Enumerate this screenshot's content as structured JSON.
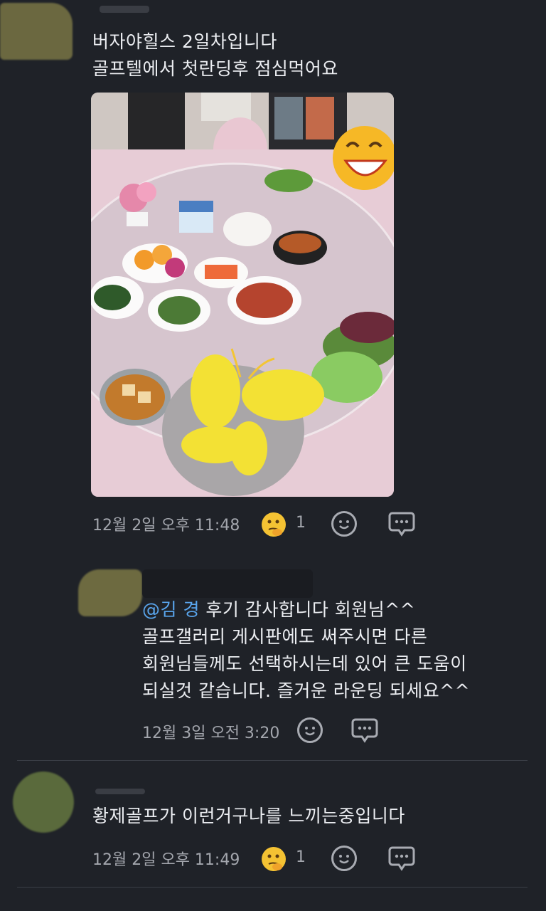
{
  "post": {
    "author_avatar": "blurred",
    "line1": "버자야힐스 2일차입니다",
    "line2": "골프텔에서 첫란딩후 점심먹어요",
    "photo_alt": "식탁 위 한식 반찬 사진",
    "timestamp": "12월 2일 오후 11:48",
    "reaction_count": "1"
  },
  "reply": {
    "mention": "@김 경",
    "line1": "후기 감사합니다 회원님^^",
    "line2": "골프갤러리 게시판에도 써주시면 다른",
    "line3": "회원님들께도 선택하시는데 있어 큰 도움이",
    "line4": "되실것 같습니다. 즐거운 라운딩 되세요^^",
    "timestamp": "12월 3일 오전 3:20"
  },
  "comment": {
    "text": "황제골프가 이런거구나를 느끼는중입니다",
    "timestamp": "12월 2일 오후 11:49",
    "reaction_count": "1"
  },
  "colors": {
    "background": "#1f2228",
    "text": "#eceef2",
    "meta": "#a3a6ad",
    "mention": "#5aa6ee"
  }
}
